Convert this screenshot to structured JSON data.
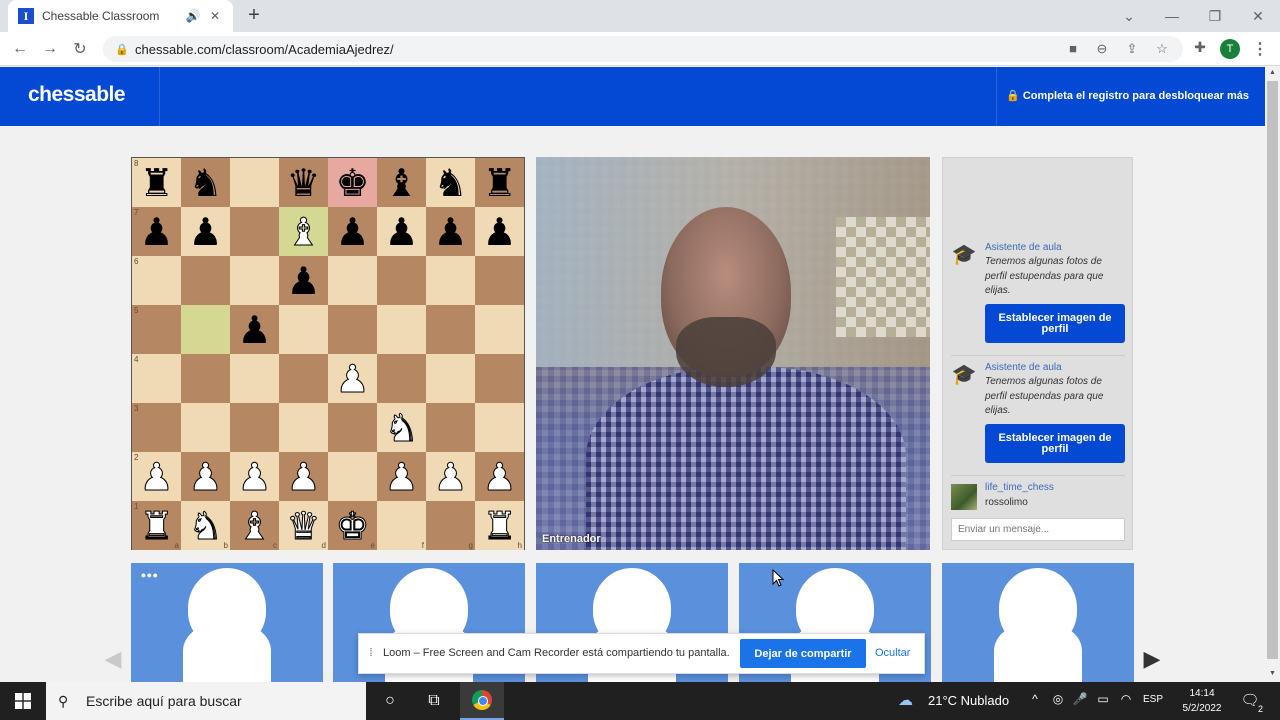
{
  "browser": {
    "tab": {
      "favicon": "I",
      "title": "Chessable Classroom",
      "audio_icon": "speaker-icon",
      "close_icon": "close-icon"
    },
    "new_tab_label": "+",
    "address": "chessable.com/classroom/AcademiaAjedrez/",
    "profile_initial": "T"
  },
  "header": {
    "logo": "chessable",
    "unlock_text": "Completa el registro para desbloquear más"
  },
  "board": {
    "orientation": "white",
    "squares": [
      [
        "br",
        "bn",
        "",
        "bq",
        "bk",
        "bb",
        "bn",
        "br"
      ],
      [
        "bp",
        "bp",
        "",
        "wb",
        "bp",
        "bp",
        "bp",
        "bp"
      ],
      [
        "",
        "",
        "",
        "bp",
        "",
        "",
        "",
        ""
      ],
      [
        "",
        "",
        "bp",
        "",
        "",
        "",
        "",
        ""
      ],
      [
        "",
        "",
        "",
        "",
        "wp",
        "",
        "",
        ""
      ],
      [
        "",
        "",
        "",
        "",
        "",
        "wn",
        "",
        ""
      ],
      [
        "wp",
        "wp",
        "wp",
        "wp",
        "",
        "wp",
        "wp",
        "wp"
      ],
      [
        "wr",
        "wn",
        "wb",
        "wq",
        "wk",
        "",
        "",
        "wr"
      ]
    ],
    "highlights": [
      "d7",
      "b5"
    ],
    "check": "e8",
    "rank_labels": [
      "8",
      "7",
      "6",
      "5",
      "4",
      "3",
      "2",
      "1"
    ],
    "file_labels": [
      "a",
      "b",
      "c",
      "d",
      "e",
      "f",
      "g",
      "h"
    ]
  },
  "video": {
    "label": "Entrenador"
  },
  "chat": {
    "messages": [
      {
        "author": "Asistente de aula",
        "text": "Tenemos algunas fotos de perfil estupendas para que elijas.",
        "button": "Establecer imagen de perfil"
      },
      {
        "author": "Asistente de aula",
        "text": "Tenemos algunas fotos de perfil estupendas para que elijas.",
        "button": "Establecer imagen de perfil"
      }
    ],
    "user_message": {
      "user": "life_time_chess",
      "text": "rossolimo"
    },
    "input_placeholder": "Enviar un mensaje..."
  },
  "participants": {
    "more_label": "•••"
  },
  "loom": {
    "message": "Loom – Free Screen and Cam Recorder está compartiendo tu pantalla.",
    "stop_button": "Dejar de compartir",
    "hide_link": "Ocultar"
  },
  "taskbar": {
    "search_placeholder": "Escribe aquí para buscar",
    "weather": "21°C  Nublado",
    "language": "ESP",
    "time": "14:14",
    "date": "5/2/2022",
    "notification_count": "2"
  }
}
